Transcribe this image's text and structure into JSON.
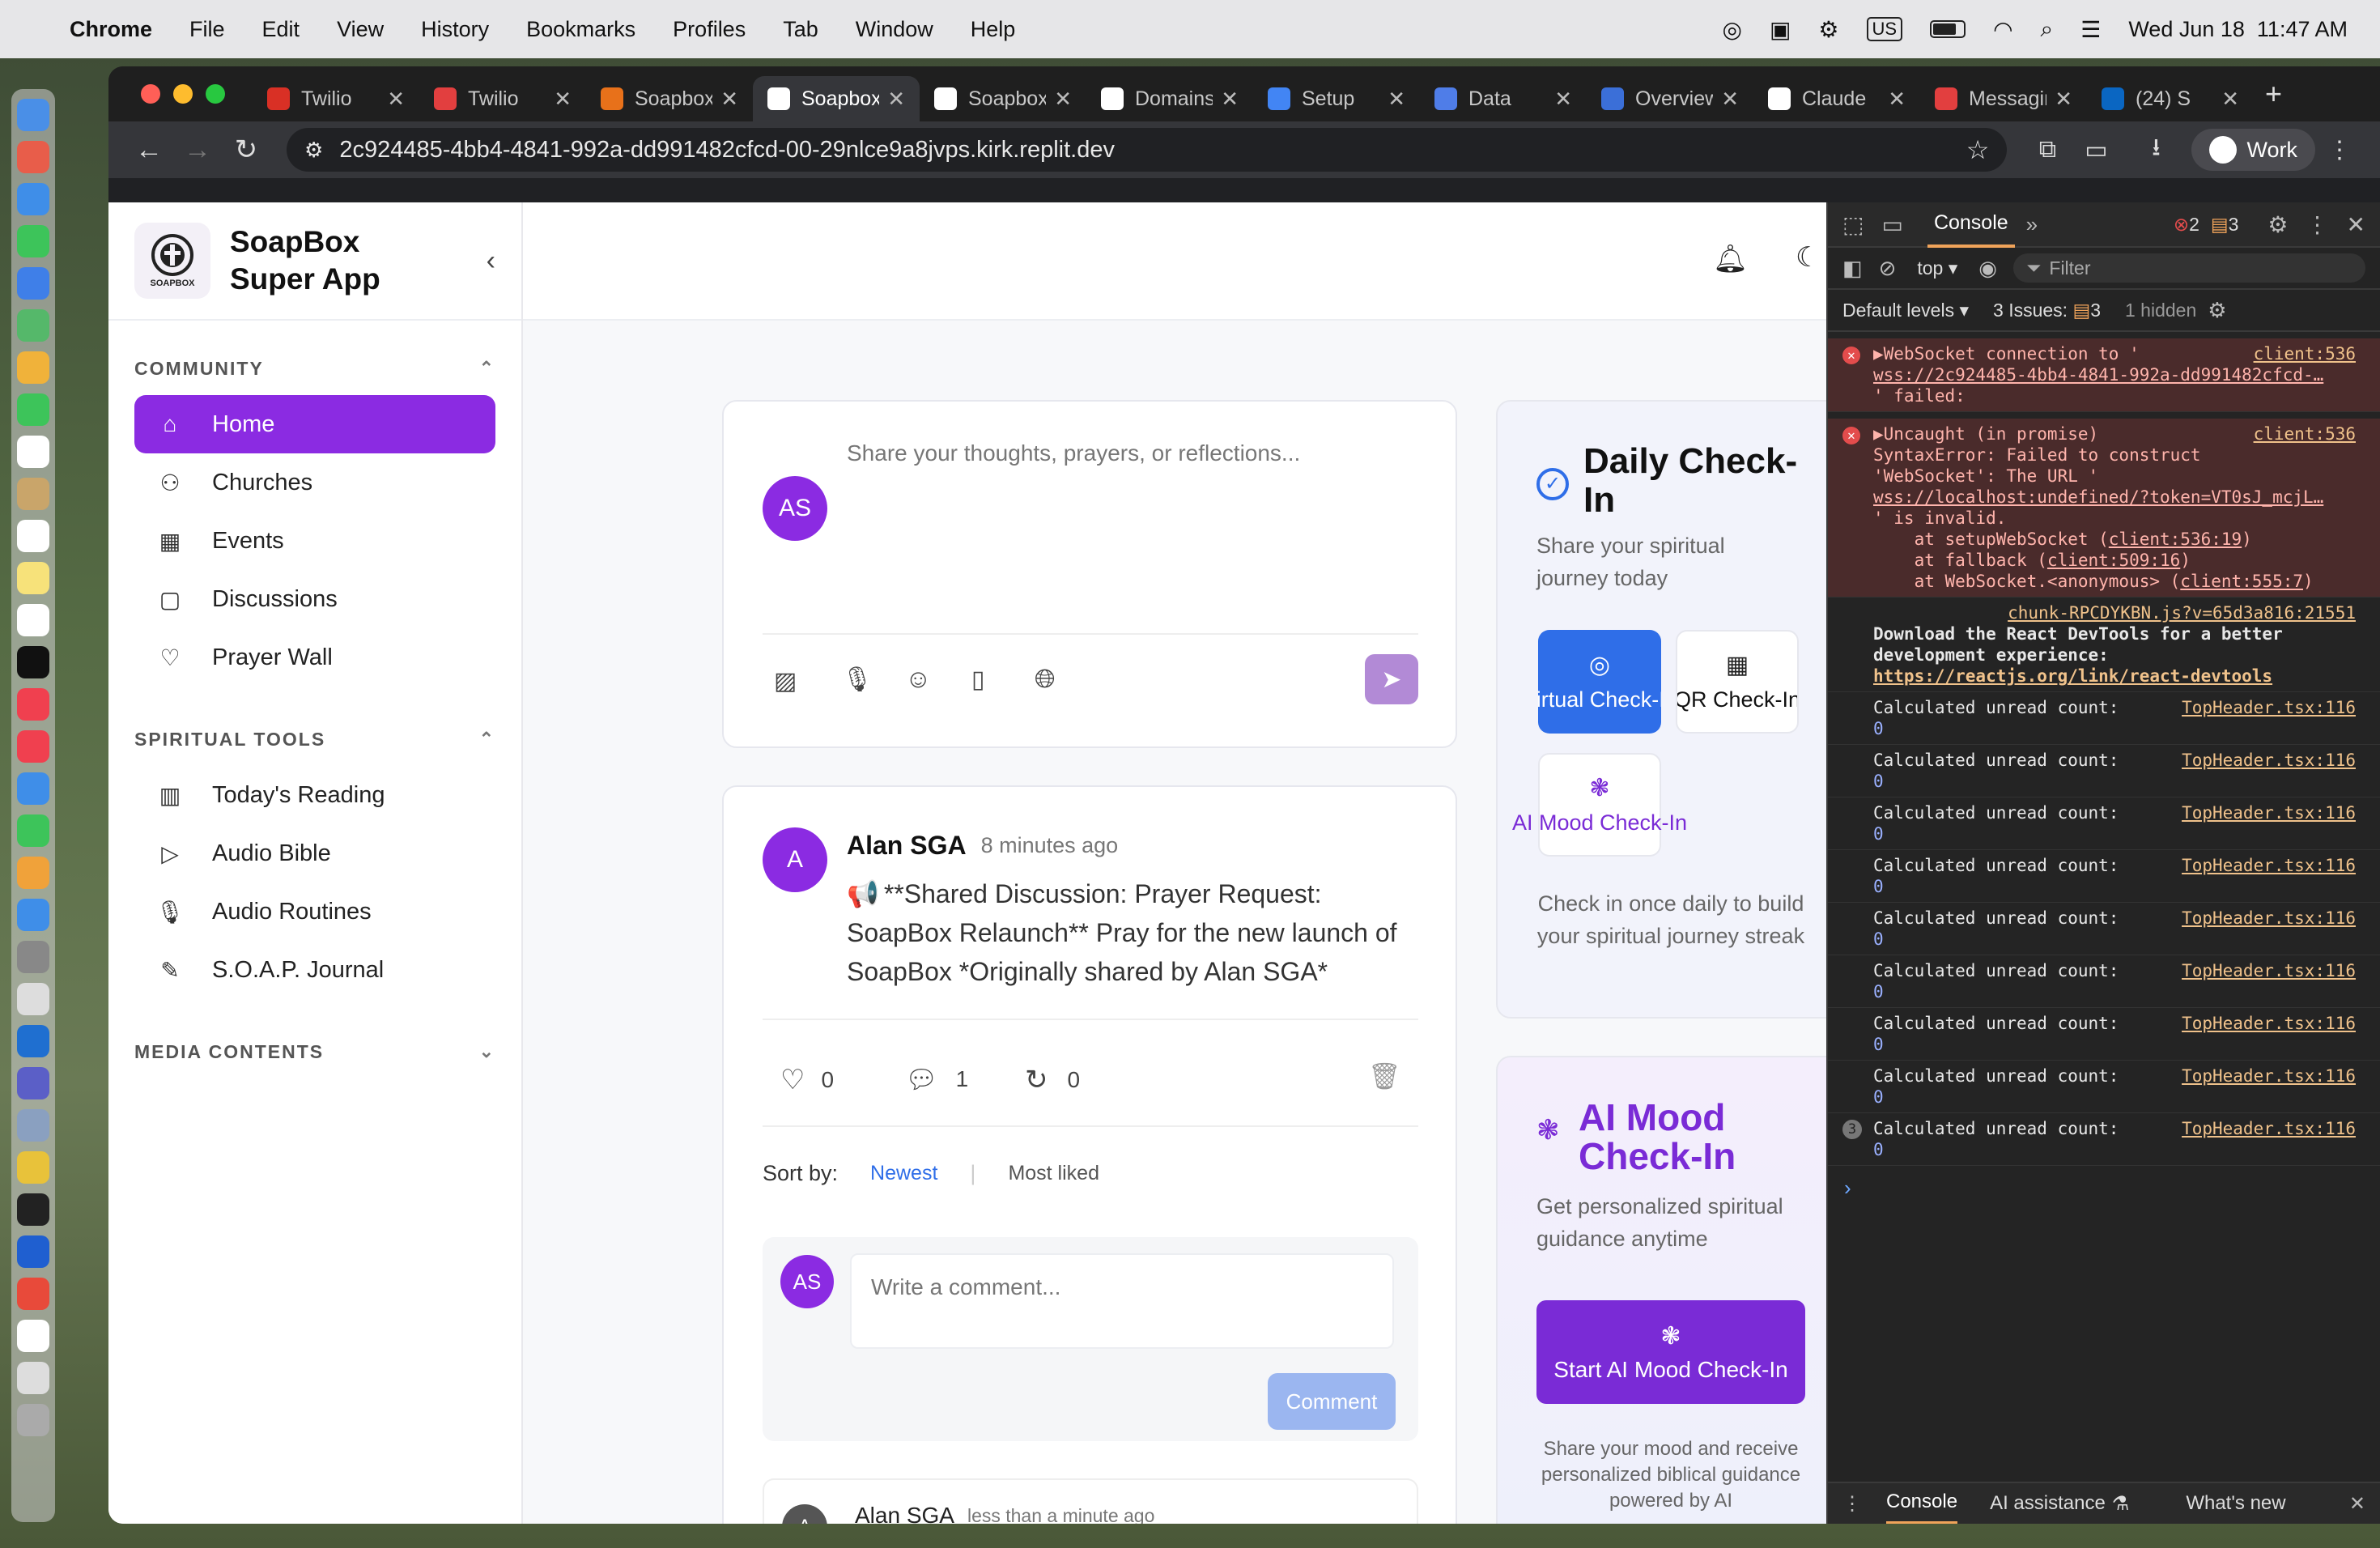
{
  "menubar": {
    "app": "Chrome",
    "items": [
      "File",
      "Edit",
      "View",
      "History",
      "Bookmarks",
      "Profiles",
      "Tab",
      "Window",
      "Help"
    ],
    "datetime": "Wed Jun 18  11:47 AM",
    "input_source": "US"
  },
  "browser": {
    "tabs": [
      {
        "title": "Twilio",
        "color": "#d93025"
      },
      {
        "title": "Twilio",
        "color": "#e23f3f"
      },
      {
        "title": "Soapbox",
        "color": "#e8711a"
      },
      {
        "title": "Soapbox",
        "color": "#ffffff"
      },
      {
        "title": "Soapbox",
        "color": "#ffffff"
      },
      {
        "title": "Domains",
        "color": "#ffffff"
      },
      {
        "title": "Setup",
        "color": "#4285f4"
      },
      {
        "title": "Data",
        "color": "#4f7de8"
      },
      {
        "title": "Overview",
        "color": "#3b6fd8"
      },
      {
        "title": "Claude",
        "color": "#ffffff"
      },
      {
        "title": "Messaging",
        "color": "#e23f3f"
      },
      {
        "title": "(24) S",
        "color": "#0a66c2"
      }
    ],
    "url": "2c924485-4bb4-4841-992a-dd991482cfcd-00-29nlce9a8jvps.kirk.replit.dev",
    "profile": "Work"
  },
  "app": {
    "brand": {
      "line1": "SoapBox",
      "line2": "Super App",
      "logo_text": "SOAPBOX"
    },
    "sections": [
      {
        "title": "COMMUNITY",
        "items": [
          {
            "label": "Home",
            "icon": "home-icon",
            "active": true
          },
          {
            "label": "Churches",
            "icon": "users-icon",
            "active": false
          },
          {
            "label": "Events",
            "icon": "calendar-icon",
            "active": false
          },
          {
            "label": "Discussions",
            "icon": "message-square-icon",
            "active": false
          },
          {
            "label": "Prayer Wall",
            "icon": "heart-icon",
            "active": false
          }
        ]
      },
      {
        "title": "SPIRITUAL TOOLS",
        "items": [
          {
            "label": "Today's Reading",
            "icon": "book-open-icon",
            "active": false
          },
          {
            "label": "Audio Bible",
            "icon": "play-icon",
            "active": false
          },
          {
            "label": "Audio Routines",
            "icon": "microphone-icon",
            "active": false
          },
          {
            "label": "S.O.A.P. Journal",
            "icon": "pen-tool-icon",
            "active": false
          }
        ]
      },
      {
        "title": "MEDIA CONTENTS",
        "items": []
      }
    ],
    "composer": {
      "avatar": "AS",
      "placeholder": "Share your thoughts, prayers, or reflections..."
    },
    "post": {
      "avatar": "A",
      "author": "Alan SGA",
      "time": "8 minutes ago",
      "emoji": "📢",
      "body": "**Shared Discussion: Prayer Request: SoapBox Relaunch** Pray for the new launch of SoapBox *Originally shared by Alan SGA*",
      "likes": "0",
      "comments": "1",
      "reposts": "0"
    },
    "sort": {
      "label": "Sort by:",
      "newest": "Newest",
      "separator": "|",
      "most_liked": "Most liked"
    },
    "comment_box": {
      "avatar": "AS",
      "placeholder": "Write a comment...",
      "button": "Comment"
    },
    "next_post": {
      "avatar": "A",
      "author": "Alan SGA",
      "time": "less than a minute ago"
    },
    "daily": {
      "title": "Daily Check-In",
      "subtitle": "Share your spiritual journey today",
      "virtual": "Virtual Check-In",
      "qr": "QR Check-In",
      "mood": "AI Mood Check-In",
      "footer": "Check in once daily to build your spiritual journey streak"
    },
    "mood_card": {
      "title": "AI Mood Check-In",
      "subtitle": "Get personalized spiritual guidance anytime",
      "button": "Start AI Mood Check-In",
      "footer": "Share your mood and receive personalized biblical guidance powered by AI"
    }
  },
  "devtools": {
    "tab": "Console",
    "errors": "2",
    "warnings": "3",
    "context": "top",
    "filter_placeholder": "Filter",
    "levels": "Default levels",
    "issues": "3 Issues:",
    "issues_count": "3",
    "hidden": "1 hidden",
    "err1": {
      "l1": "▶WebSocket connection to '",
      "l2": "wss://2c924485-4bb4-4841-992a-dd991482cfcd-…",
      "l3": "' failed:",
      "src": "client:536"
    },
    "err2": {
      "l1": "▶Uncaught (in promise)",
      "l2": "SyntaxError: Failed to construct",
      "l3": "'WebSocket': The URL '",
      "l4": "wss://localhost:undefined/?token=VT0sJ_mcjL…",
      "l5": "' is invalid.",
      "l6a": "    at setupWebSocket (",
      "l6b": "client:536:19",
      "l6c": ")",
      "l7a": "    at fallback (",
      "l7b": "client:509:16",
      "l7c": ")",
      "l8a": "    at WebSocket.<anonymous> (",
      "l8b": "client:555:7",
      "l8c": ")",
      "src": "client:536"
    },
    "info": {
      "src": "chunk-RPCDYKBN.js?v=65d3a816:21551",
      "l1": "Download the React DevTools for a better",
      "l2": "development experience:",
      "link": "https://reactjs.org/link/react-devtools"
    },
    "count_line": "Calculated unread count:",
    "count_src": "TopHeader.tsx:116",
    "count_val": "0",
    "repeat_badge": "3",
    "drawer": {
      "console": "Console",
      "ai": "AI assistance",
      "whats_new": "What's new"
    }
  }
}
